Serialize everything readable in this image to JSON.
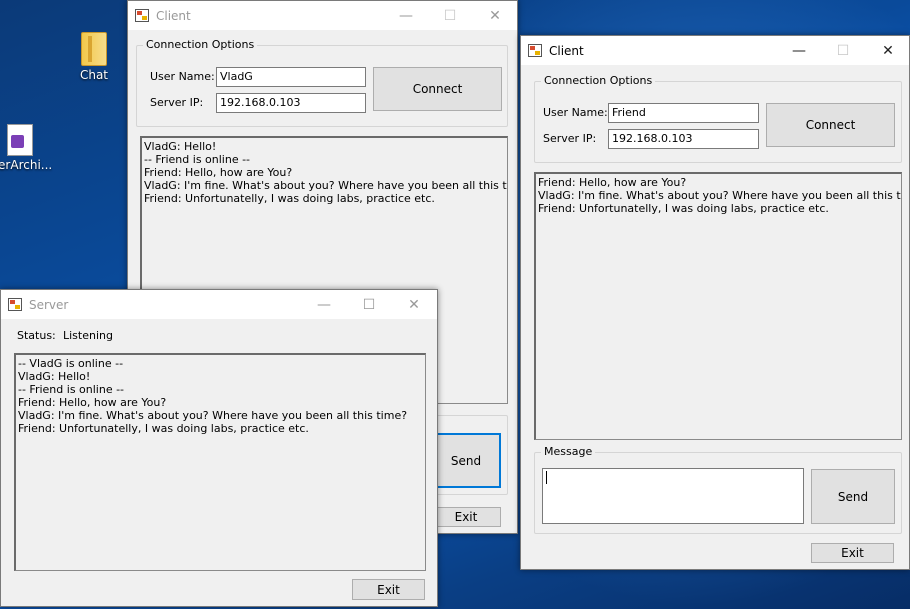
{
  "desktop": {
    "icons": [
      {
        "label": "Chat",
        "icon": "folder-icon"
      },
      {
        "label": "TierArchi...",
        "icon": "visual-studio-project-icon"
      }
    ]
  },
  "client1": {
    "title": "Client",
    "connection_group": "Connection Options",
    "username_label": "User Name:",
    "username_value": "VladG",
    "server_ip_label": "Server IP:",
    "server_ip_value": "192.168.0.103",
    "connect_label": "Connect",
    "messages": [
      "VladG: Hello!",
      "-- Friend is online --",
      "Friend: Hello, how are You?",
      "VladG: I'm fine. What's about you? Where have you been all this time?",
      "Friend: Unfortunatelly, I was doing labs, practice etc."
    ],
    "send_label": "Send",
    "exit_label": "Exit"
  },
  "client2": {
    "title": "Client",
    "connection_group": "Connection Options",
    "username_label": "User Name:",
    "username_value": "Friend",
    "server_ip_label": "Server IP:",
    "server_ip_value": "192.168.0.103",
    "connect_label": "Connect",
    "messages": [
      "Friend: Hello, how are You?",
      "VladG: I'm fine. What's about you? Where have you been all this time?",
      "Friend: Unfortunatelly, I was doing labs, practice etc."
    ],
    "message_group": "Message",
    "message_value": "",
    "send_label": "Send",
    "exit_label": "Exit"
  },
  "server": {
    "title": "Server",
    "status_label": "Status:",
    "status_value": "Listening",
    "log": [
      "-- VladG is online --",
      "VladG: Hello!",
      "-- Friend is online --",
      "Friend: Hello, how are You?",
      "VladG: I'm fine. What's about you? Where have you been all this time?",
      "Friend: Unfortunatelly, I was doing labs, practice etc."
    ],
    "exit_label": "Exit"
  },
  "titlebar_glyphs": {
    "minimize": "—",
    "maximize": "☐",
    "close": "✕"
  }
}
